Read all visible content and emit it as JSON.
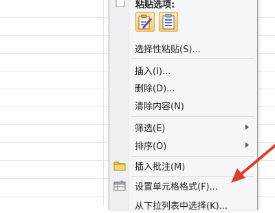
{
  "menu": {
    "header": "粘贴选项:",
    "items": [
      {
        "label": "选择性粘贴(S)..."
      },
      {
        "label": "插入(I)..."
      },
      {
        "label": "删除(D)..."
      },
      {
        "label": "清除内容(N)"
      },
      {
        "label": "筛选(E)"
      },
      {
        "label": "排序(O)"
      },
      {
        "label": "插入批注(M)"
      },
      {
        "label": "设置单元格格式(F)..."
      },
      {
        "label": "从下拉列表中选择(K)..."
      }
    ]
  },
  "colors": {
    "annotation_arrow": "#e03a2e",
    "menu_bg": "#f5f6f7",
    "paste_button": "#fbcb6c"
  }
}
